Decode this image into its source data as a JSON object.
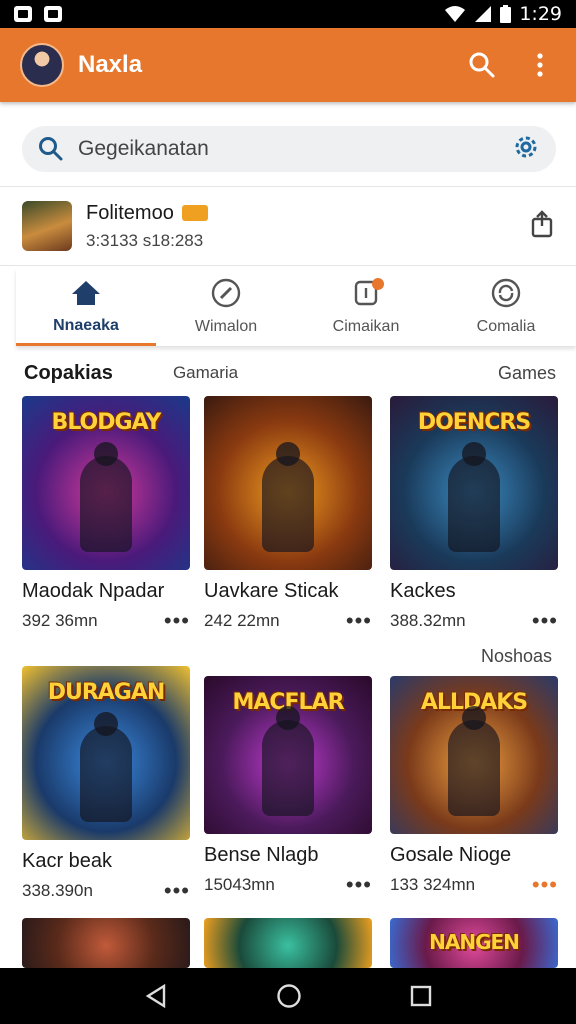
{
  "status_bar": {
    "time": "1:29"
  },
  "app_bar": {
    "title": "Naxla"
  },
  "search": {
    "placeholder": "Gegeikanatan"
  },
  "profile": {
    "name": "Folitemoo",
    "subtitle": "3:3133 s18:283"
  },
  "tabs": [
    {
      "label": "Nnaeaka",
      "icon": "home-icon",
      "active": true
    },
    {
      "label": "Wimalon",
      "icon": "pencil-icon",
      "active": false
    },
    {
      "label": "Cimaikan",
      "icon": "notification-icon",
      "active": false,
      "badge": true
    },
    {
      "label": "Comalia",
      "icon": "compass-icon",
      "active": false
    }
  ],
  "section": {
    "title": "Copakias",
    "middle": "Gamaria",
    "right": "Games"
  },
  "row2_label": "Noshoas",
  "cards": [
    {
      "title": "Maodak Npadar",
      "meta": "392 36mn",
      "banner": "BLODGAY",
      "colors": [
        "#4a1a7a",
        "#d23a9a",
        "#1a3a8a"
      ]
    },
    {
      "title": "Uavkare Sticak",
      "meta": "242 22mn",
      "banner": "",
      "colors": [
        "#8a3a10",
        "#f09a20",
        "#3a1a10"
      ]
    },
    {
      "title": "Kackes",
      "meta": "388.32mn",
      "banner": "DOENCRS",
      "colors": [
        "#1a3a5a",
        "#3a8ac0",
        "#2a1a3a"
      ]
    },
    {
      "title": "Kacr beak",
      "meta": "338.390n",
      "banner": "DURAGAN",
      "colors": [
        "#1a3a6a",
        "#3a8ae0",
        "#f0c030"
      ]
    },
    {
      "title": "Bense Nlagb",
      "meta": "15043mn",
      "banner": "MACFLAR",
      "colors": [
        "#4a1a5a",
        "#c03ad0",
        "#2a0a2a"
      ]
    },
    {
      "title": "Gosale Nioge",
      "meta": "133 324mn",
      "banner": "ALLDAKS",
      "colors": [
        "#7a3a1a",
        "#f0a040",
        "#2a3a6a"
      ]
    },
    {
      "title": "",
      "meta": "",
      "banner": "",
      "colors": [
        "#5a2a1a",
        "#c05a3a",
        "#2a1a1a"
      ]
    },
    {
      "title": "",
      "meta": "",
      "banner": "",
      "colors": [
        "#1a4a3a",
        "#3ac0a0",
        "#f0a020"
      ]
    },
    {
      "title": "",
      "meta": "",
      "banner": "NANGEN",
      "colors": [
        "#6a1a4a",
        "#e04a9a",
        "#3a6ad0"
      ]
    }
  ],
  "colors": {
    "accent": "#e8772e",
    "tab_active": "#1f3f6a",
    "search_bg": "#eef0f2"
  }
}
